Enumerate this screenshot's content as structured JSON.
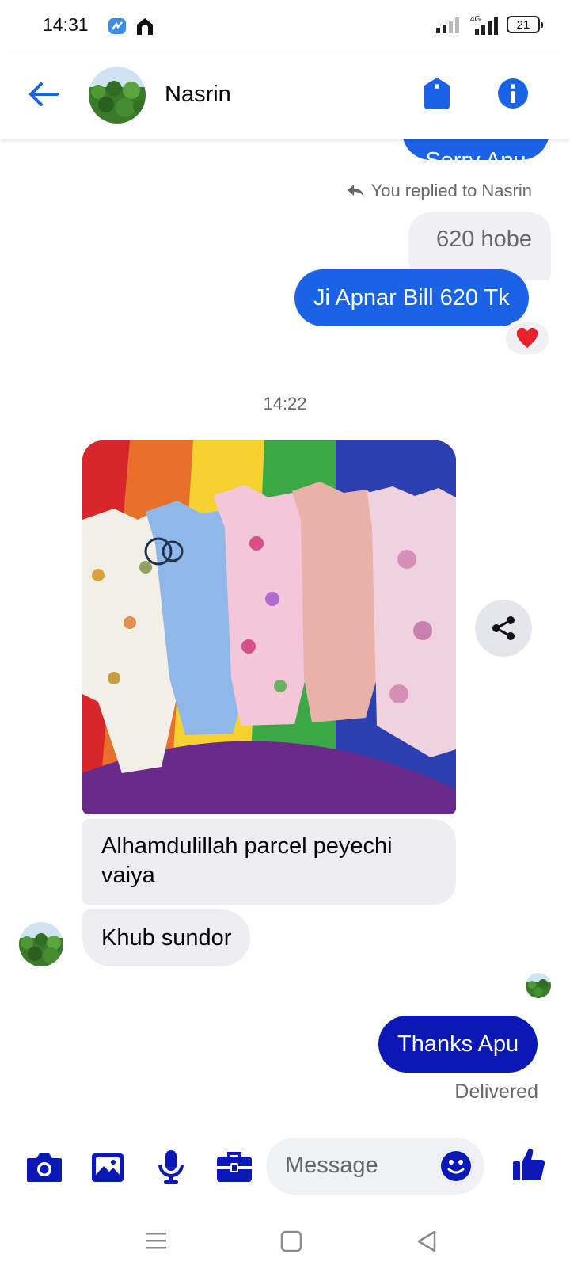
{
  "status_bar": {
    "time": "14:31",
    "network": "4G",
    "battery": "21"
  },
  "header": {
    "contact_name": "Nasrin"
  },
  "colors": {
    "messenger_blue": "#1a62e6",
    "navy_bubble": "#0a18b5",
    "composer_icon": "#0a18b5",
    "grey_bubble": "#eeeef2",
    "muted_text": "#65676b"
  },
  "messages": {
    "cut_off_sent": "Sorry Apu",
    "reply_indicator": "You replied to Nasrin",
    "quoted_text": "620 hobe",
    "sent_bill": "Ji Apnar Bill 620 Tk",
    "reaction": "heart",
    "timestamp": "14:22",
    "received_parcel": "Alhamdulillah parcel  peyechi vaiya",
    "received_compliment": "Khub sundor",
    "sent_thanks": "Thanks Apu",
    "delivery_status": "Delivered"
  },
  "composer": {
    "placeholder": "Message",
    "icons": [
      "camera-icon",
      "gallery-icon",
      "microphone-icon",
      "briefcase-icon",
      "emoji-icon",
      "thumbs-up-icon"
    ]
  },
  "nav_bar": {
    "icons": [
      "menu-icon",
      "home-icon",
      "back-triangle-icon"
    ]
  }
}
